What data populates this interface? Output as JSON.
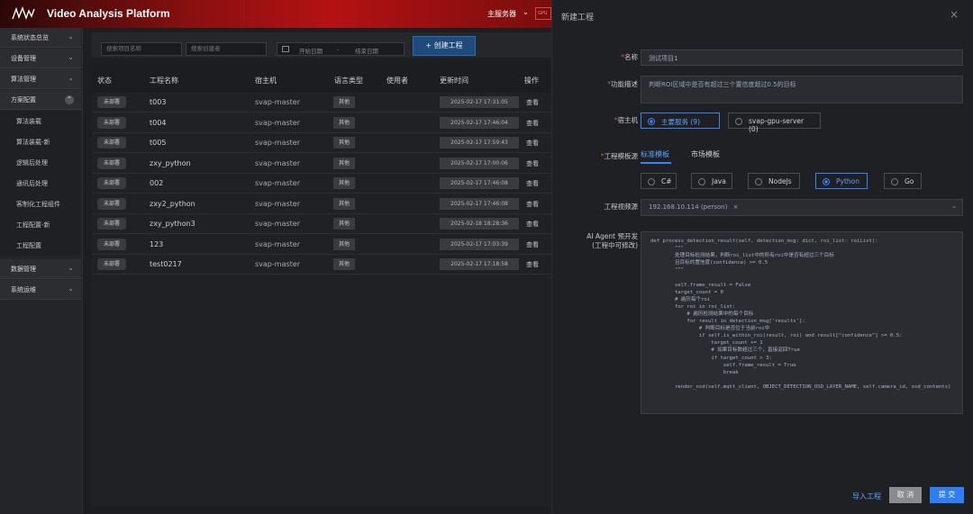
{
  "app": {
    "title": "Video Analysis Platform",
    "host_select": "主服务器",
    "gpu_tag": "GPU"
  },
  "sidebar": {
    "items": [
      {
        "label": "系统状态总览"
      },
      {
        "label": "设备管理"
      },
      {
        "label": "算法管理"
      },
      {
        "label": "方案配置"
      },
      {
        "label": "数据管理"
      },
      {
        "label": "系统运维"
      }
    ],
    "subitems": [
      {
        "label": "算法装载"
      },
      {
        "label": "算法装载-新"
      },
      {
        "label": "逻辑后处理"
      },
      {
        "label": "通讯后处理"
      },
      {
        "label": "客制化工程组件"
      },
      {
        "label": "工程配置-新"
      },
      {
        "label": "工程配置"
      }
    ]
  },
  "filters": {
    "project_name_placeholder": "搜索项目名称",
    "creator_placeholder": "搜索创建者",
    "start_date": "开始日期",
    "separator": "-",
    "end_date": "结束日期",
    "create_button": "+ 创建工程"
  },
  "table": {
    "headers": [
      "状态",
      "工程名称",
      "宿主机",
      "语言类型",
      "使用者",
      "更新时间",
      "操作"
    ],
    "rows": [
      {
        "status": "未部署",
        "name": "t003",
        "host": "svap-master",
        "lang": "其他",
        "updated": "2025-02-17 17:31:05",
        "op": "查看"
      },
      {
        "status": "未部署",
        "name": "t004",
        "host": "svap-master",
        "lang": "其他",
        "updated": "2025-02-17 17:46:04",
        "op": "查看"
      },
      {
        "status": "未部署",
        "name": "t005",
        "host": "svap-master",
        "lang": "其他",
        "updated": "2025-02-17 17:59:43",
        "op": "查看"
      },
      {
        "status": "未部署",
        "name": "zxy_python",
        "host": "svap-master",
        "lang": "其他",
        "updated": "2025-02-17 17:00:06",
        "op": "查看"
      },
      {
        "status": "未部署",
        "name": "002",
        "host": "svap-master",
        "lang": "其他",
        "updated": "2025-02-17 17:46:08",
        "op": "查看"
      },
      {
        "status": "未部署",
        "name": "zxy2_python",
        "host": "svap-master",
        "lang": "其他",
        "updated": "2025-02-17 17:46:08",
        "op": "查看"
      },
      {
        "status": "未部署",
        "name": "zxy_python3",
        "host": "svap-master",
        "lang": "其他",
        "updated": "2025-02-18 18:28:36",
        "op": "查看"
      },
      {
        "status": "未部署",
        "name": "123",
        "host": "svap-master",
        "lang": "其他",
        "updated": "2025-02-17 17:03:39",
        "op": "查看"
      },
      {
        "status": "未部署",
        "name": "test0217",
        "host": "svap-master",
        "lang": "其他",
        "updated": "2025-02-17 17:18:58",
        "op": "查看"
      }
    ]
  },
  "dialog": {
    "title": "新建工程",
    "close": "×",
    "name_label": "名称",
    "name_value": "测试项目1",
    "desc_label": "功能描述",
    "desc_value": "判断ROI区域中是否有超过三个置信度超过0.5的目标",
    "host_label": "宿主机",
    "hosts": [
      "主要服务 (9)",
      "svap-gpu-server (0)"
    ],
    "template_source_label": "工程模板源",
    "template_tabs": [
      "标准模板",
      "市场模板"
    ],
    "languages": [
      "C#",
      "Java",
      "NodeJs",
      "Python",
      "Go"
    ],
    "video_source_label": "工程视频源",
    "video_source_value": "192.168.10.114 (person)",
    "video_source_remove": "×",
    "ai_label_1": "AI Agent 预开发",
    "ai_label_2": "(工程中可修改)",
    "code": "def process_detection_result(self, detection_msg: dict, roi_list: roiList):\n        \"\"\"\n        处理目标检测结果，判断roi_list中的所有roi中是否有超过三个目标\n        且目标的置信度(confidence) >= 0.5\n        \"\"\"\n\n        self.frame_result = False\n        target_count = 0\n        # 遍历每个roi\n        for roi in roi_list:\n            # 遍历检测结果中的每个目标\n            for result in detection_msg['results']:\n                # 判断目标是否位于当前roi中\n                if self.is_within_roi(result, roi) and result[\"confidence\"] >= 0.5:\n                    target_count += 1\n                    # 如果目标数超过三个，直接返回True\n                    if target_count > 3:\n                        self.frame_result = True\n                        break\n\n        render_osd(self.mqtt_client, OBJECT_DETECTION_OSD_LAYER_NAME, self.camera_id, osd_contents)",
    "import_link": "导入工程",
    "cancel_button": "取 消",
    "submit_button": "提 交"
  }
}
